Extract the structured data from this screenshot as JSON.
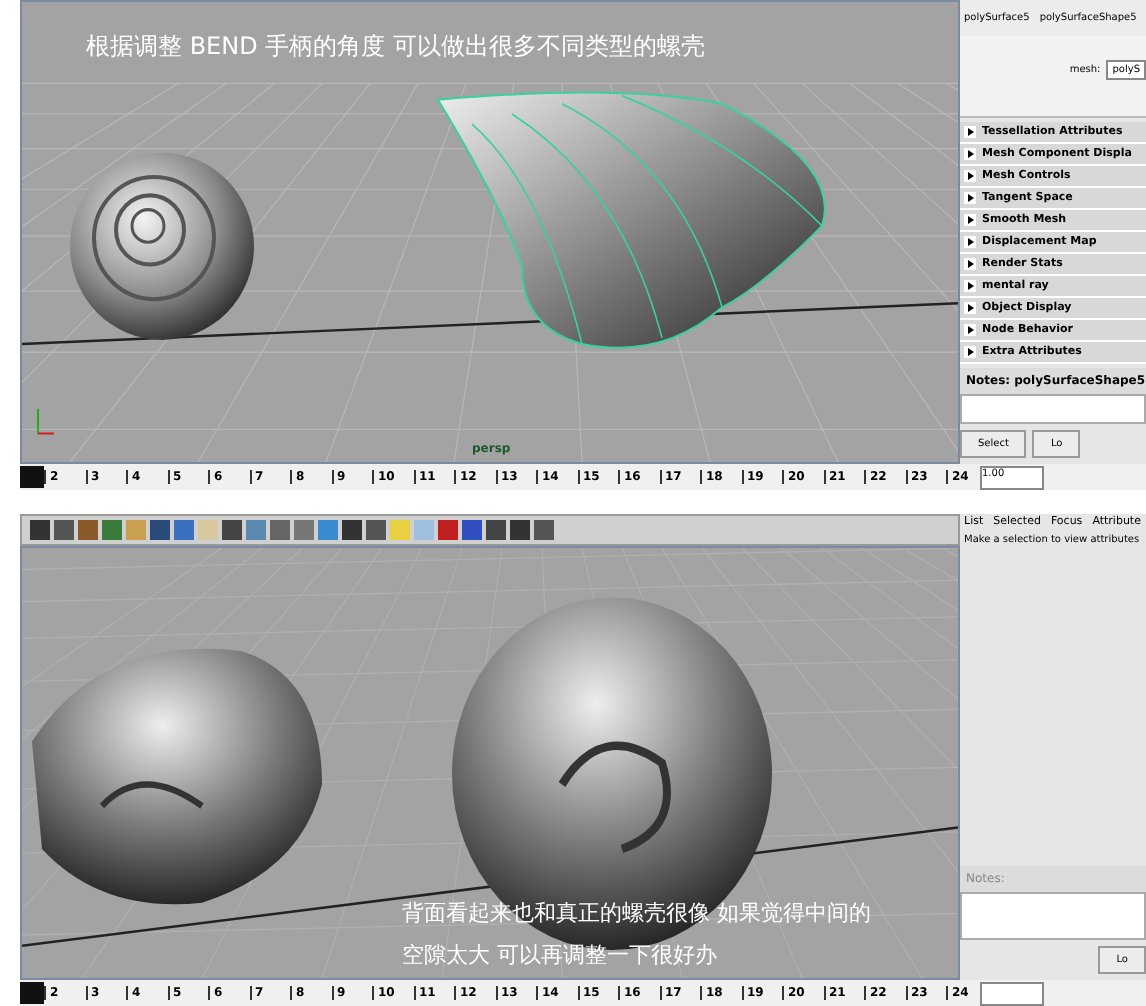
{
  "top_panel": {
    "caption": "根据调整 BEND 手柄的角度 可以做出很多不同类型的螺壳",
    "camera_label": "persp",
    "attribute_editor": {
      "tabs": [
        "polySurface5",
        "polySurfaceShape5"
      ],
      "mesh_label": "mesh:",
      "mesh_value": "polyS",
      "sections": [
        "Tessellation Attributes",
        "Mesh Component Displa",
        "Mesh Controls",
        "Tangent Space",
        "Smooth Mesh",
        "Displacement Map",
        "Render Stats",
        "mental ray",
        "Object Display",
        "Node Behavior",
        "Extra Attributes"
      ],
      "notes_label": "Notes:  polySurfaceShape5",
      "buttons": [
        "Select",
        "Lo"
      ]
    },
    "timeline": {
      "ticks": [
        "2",
        "3",
        "4",
        "5",
        "6",
        "7",
        "8",
        "9",
        "10",
        "11",
        "12",
        "13",
        "14",
        "15",
        "16",
        "17",
        "18",
        "19",
        "20",
        "21",
        "22",
        "23",
        "24"
      ],
      "level": 0,
      "current_frame": "1.00"
    }
  },
  "bottom_panel": {
    "caption_lines": [
      "背面看起来也和真正的螺壳很像 如果觉得中间的",
      "空隙太大 可以再调整一下很好办"
    ],
    "attribute_editor": {
      "menu": [
        "List",
        "Selected",
        "Focus",
        "Attribute"
      ],
      "message": "Make a selection to view attributes",
      "notes_label": "Notes:",
      "buttons": [
        "Lo"
      ]
    },
    "timeline": {
      "ticks": [
        "2",
        "3",
        "4",
        "5",
        "6",
        "7",
        "8",
        "9",
        "10",
        "11",
        "12",
        "13",
        "14",
        "15",
        "16",
        "17",
        "18",
        "19",
        "20",
        "21",
        "22",
        "23",
        "24"
      ],
      "level": 0
    }
  }
}
